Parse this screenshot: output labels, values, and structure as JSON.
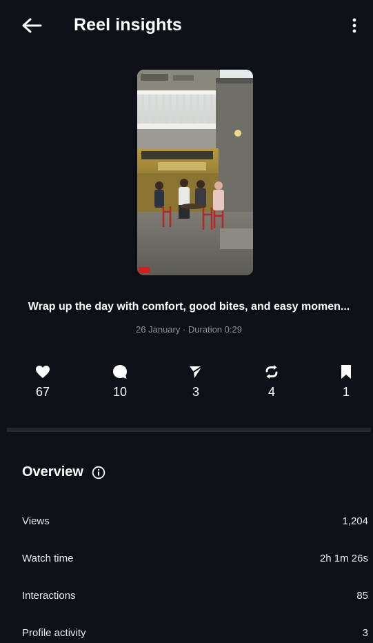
{
  "header": {
    "title": "Reel insights",
    "back_icon": "arrow-left-icon",
    "more_icon": "more-vertical-icon"
  },
  "reel": {
    "caption": "Wrap up the day with comfort, good bites, and easy momen...",
    "meta": "26 January · Duration 0:29"
  },
  "stats": [
    {
      "icon": "heart-icon",
      "value": "67"
    },
    {
      "icon": "comment-icon",
      "value": "10"
    },
    {
      "icon": "share-icon",
      "value": "3"
    },
    {
      "icon": "repost-icon",
      "value": "4"
    },
    {
      "icon": "bookmark-icon",
      "value": "1"
    }
  ],
  "overview": {
    "title": "Overview",
    "info_icon": "info-icon",
    "rows": [
      {
        "label": "Views",
        "value": "1,204"
      },
      {
        "label": "Watch time",
        "value": "2h 1m 26s"
      },
      {
        "label": "Interactions",
        "value": "85"
      },
      {
        "label": "Profile activity",
        "value": "3"
      }
    ]
  },
  "colors": {
    "background": "#0d1016",
    "divider": "#23272f",
    "meta_text": "#8e939c"
  }
}
